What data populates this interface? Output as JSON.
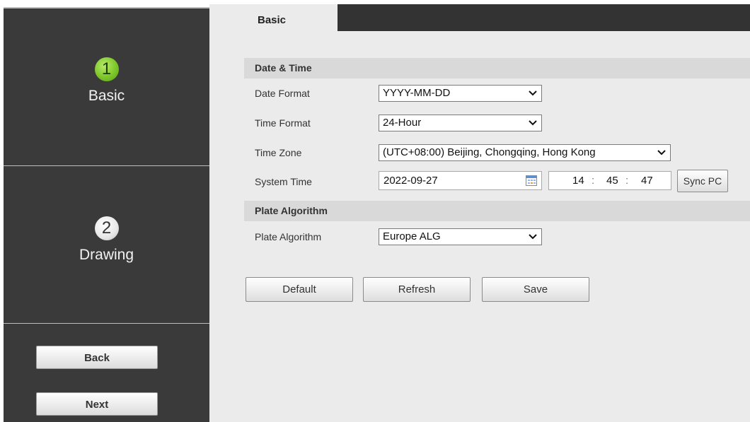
{
  "sidebar": {
    "steps": [
      {
        "number": "1",
        "label": "Basic"
      },
      {
        "number": "2",
        "label": "Drawing"
      }
    ],
    "back_label": "Back",
    "next_label": "Next"
  },
  "tabs": [
    {
      "label": "Basic"
    }
  ],
  "date_time": {
    "section_title": "Date & Time",
    "date_format": {
      "label": "Date Format",
      "value": "YYYY-MM-DD"
    },
    "time_format": {
      "label": "Time Format",
      "value": "24-Hour"
    },
    "time_zone": {
      "label": "Time Zone",
      "value": "(UTC+08:00) Beijing, Chongqing, Hong Kong"
    },
    "system_time": {
      "label": "System Time",
      "date": "2022-09-27",
      "hour": "14",
      "minute": "45",
      "second": "47",
      "separator": ":",
      "sync_label": "Sync PC"
    }
  },
  "plate": {
    "section_title": "Plate Algorithm",
    "label": "Plate Algorithm",
    "value": "Europe ALG"
  },
  "actions": {
    "default_label": "Default",
    "refresh_label": "Refresh",
    "save_label": "Save"
  },
  "icons": {
    "dropdown": "chevron-down-icon",
    "calendar": "calendar-icon"
  },
  "colors": {
    "active_step": "#7cc629",
    "sidebar_bg": "#3a3a3a",
    "panel_bg": "#ebebeb"
  }
}
